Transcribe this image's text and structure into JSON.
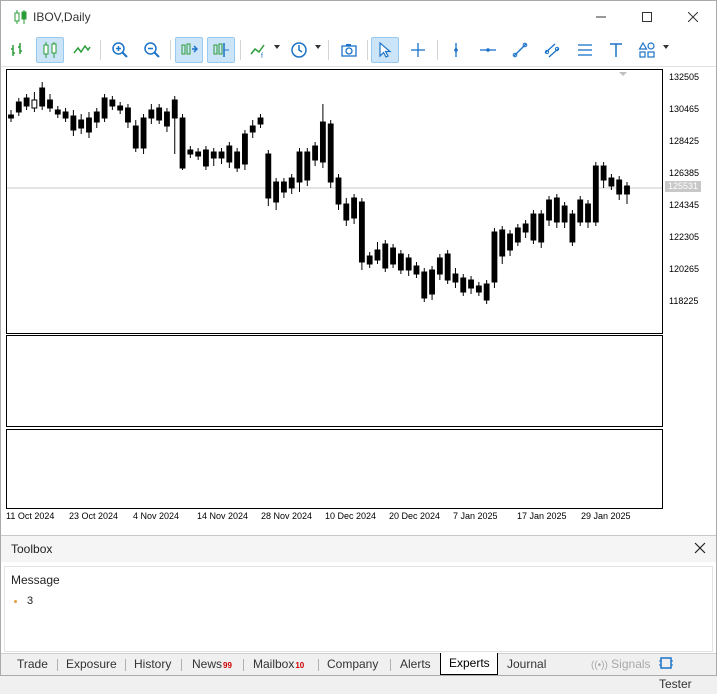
{
  "window": {
    "title": "IBOV,Daily"
  },
  "chart": {
    "price_labels": [
      "132505",
      "130465",
      "128425",
      "126385",
      "124345",
      "122305",
      "120265",
      "118225"
    ],
    "current_price": "125531",
    "date_labels": [
      "11 Oct 2024",
      "23 Oct 2024",
      "4 Nov 2024",
      "14 Nov 2024",
      "28 Nov 2024",
      "10 Dec 2024",
      "20 Dec 2024",
      "7 Jan 2025",
      "17 Jan 2025",
      "29 Jan 2025"
    ],
    "colors": {
      "bull": "#ffffff",
      "bear": "#000000",
      "outline": "#000000",
      "price_line": "#c8c8c8"
    }
  },
  "toolbox": {
    "title": "Toolbox",
    "message_header": "Message",
    "message_value": "3",
    "tabs": [
      {
        "label": "Trade",
        "badge": ""
      },
      {
        "label": "Exposure",
        "badge": ""
      },
      {
        "label": "History",
        "badge": ""
      },
      {
        "label": "News",
        "badge": "99"
      },
      {
        "label": "Mailbox",
        "badge": "10"
      },
      {
        "label": "Company",
        "badge": ""
      },
      {
        "label": "Alerts",
        "badge": ""
      },
      {
        "label": "Experts",
        "badge": ""
      },
      {
        "label": "Journal",
        "badge": ""
      }
    ],
    "signals_label": "Signals",
    "tester_label": "Tester"
  }
}
